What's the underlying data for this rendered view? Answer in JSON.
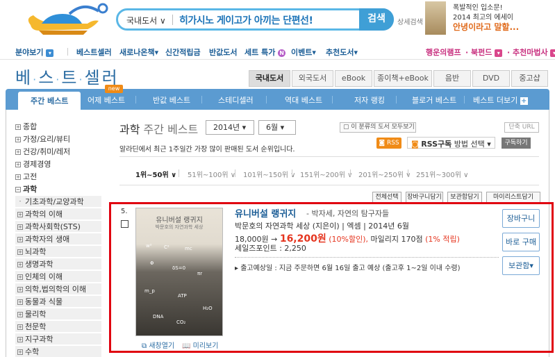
{
  "header": {
    "search": {
      "category": "국내도서",
      "query": "히가시노 게이고가 아끼는 단편선!",
      "button": "검색",
      "advanced": "상세검색"
    },
    "ad": {
      "line1": "폭발적인 입소문!",
      "line2": "2014 최고의 에세이",
      "line3": "안녕이라고 말할..."
    }
  },
  "gnb": {
    "items": [
      "분야보기",
      "베스트셀러",
      "새로나온책",
      "신간적립금",
      "반값도서",
      "세트 특가",
      "이벤트",
      "추천도서"
    ],
    "right": [
      "행운의램프",
      "북펀드",
      "추천마법사"
    ]
  },
  "best_title": [
    "베",
    "스",
    "트",
    "셀러"
  ],
  "category_tabs": [
    "국내도서",
    "외국도서",
    "eBook",
    "종이책+eBook",
    "음반",
    "DVD",
    "중고샵"
  ],
  "best_tabs": [
    "주간 베스트",
    "어제 베스트",
    "반값 베스트",
    "스테디셀러",
    "역대 베스트",
    "저자 랭킹",
    "블로거 베스트",
    "베스트 더보기"
  ],
  "new_badge": "new",
  "sidebar": [
    "종합",
    "가정/요리/뷰티",
    "건강/취미/레저",
    "경제경영",
    "고전",
    "과학",
    "기초과학/교양과학",
    "과학의 이해",
    "과학사회학(STS)",
    "과학자의 생애",
    "뇌과학",
    "생명과학",
    "인체의 이해",
    "의학,법의학의 이해",
    "동물과 식물",
    "물리학",
    "천문학",
    "지구과학",
    "수학"
  ],
  "main": {
    "title_cat": "과학",
    "title_rest": "주간 베스트",
    "year": "2014년",
    "month": "6월",
    "all_cat": "이 분류의 도서 모두보기",
    "short_url": "단축 URL",
    "desc": "알라딘에서 최근 1주일간 가장 많이 판매된 도서 순위입니다.",
    "rss_badge": "RSS",
    "rss_label": "RSS구독",
    "rss_method": "방법 선택",
    "subscribe": "구독하기",
    "ranges": [
      "1위~50위",
      "51위~100위",
      "101위~150위",
      "151위~200위",
      "201위~250위",
      "251위~300위"
    ],
    "actions": [
      "전체선택",
      "장바구니담기",
      "보관함담기",
      "마이리스트담기"
    ]
  },
  "item": {
    "rank": "5.",
    "cover_title": "유니버설 랭귀지",
    "cover_sub": "박문호의 자연과학 세상",
    "title": "유니버설 랭귀지",
    "subtitle": "- 박자세, 자연의 탐구자들",
    "author_line": "박문호의 자연과학 세상 (지은이) | 엑셈 | 2014년 6월",
    "price_orig": "18,000원",
    "arrow": "→",
    "price_sale": "16,200원",
    "discount": "(10%할인),",
    "mileage": "마일리지 170점",
    "mileage_rate": "(1% 적립)",
    "sales_point": "세일즈포인트 : 2,250",
    "shipping": "출고예상일 : 지금 주문하면 6월 16일 출고 예상 (출고후 1~2일 이내 수령)",
    "buttons": [
      "장바구니",
      "바로 구매",
      "보관함"
    ],
    "links": [
      "새창열기",
      "미리보기"
    ]
  },
  "colors": {
    "accent": "#5b9bd1",
    "brand_blue": "#1b5d96",
    "price_red": "#e5351f",
    "highlight": "#e0000f"
  }
}
